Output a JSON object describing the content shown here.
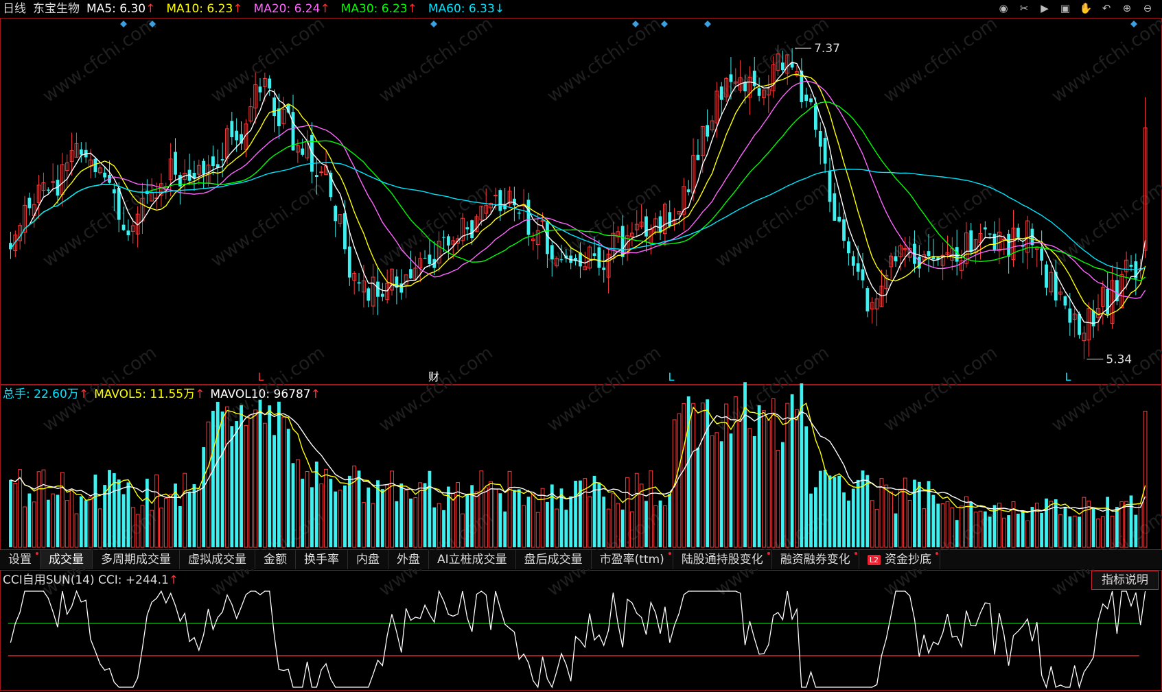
{
  "header": {
    "period": "日线",
    "stock_name": "东宝生物",
    "ma": [
      {
        "label": "MA5:",
        "value": "6.30",
        "arrow": "↑",
        "color": "#ffffff"
      },
      {
        "label": "MA10:",
        "value": "6.23",
        "arrow": "↑",
        "color": "#ffff00"
      },
      {
        "label": "MA20:",
        "value": "6.24",
        "arrow": "↑",
        "color": "#ff66ff"
      },
      {
        "label": "MA30:",
        "value": "6.23",
        "arrow": "↑",
        "color": "#00ff00"
      },
      {
        "label": "MA60:",
        "value": "6.33",
        "arrow": "↓",
        "color": "#00e5ff"
      }
    ]
  },
  "toolbar_icons": [
    "eye-icon",
    "scissors-icon",
    "play-circle-icon",
    "lock-icon",
    "hand-icon",
    "undo-icon",
    "zoom-in-icon",
    "zoom-out-icon"
  ],
  "price_annotations": {
    "high": "7.37",
    "low": "5.34"
  },
  "event_markers": [
    {
      "text": "L",
      "color": "#ff3333"
    },
    {
      "text": "财",
      "color": "#ffffff"
    },
    {
      "text": "L",
      "color": "#00e5ff"
    },
    {
      "text": "L",
      "color": "#00e5ff"
    }
  ],
  "volume_header": {
    "total": {
      "label": "总手:",
      "value": "22.60万",
      "arrow": "↑"
    },
    "mavol5": {
      "label": "MAVOL5:",
      "value": "11.55万",
      "arrow": "↑"
    },
    "mavol10": {
      "label": "MAVOL10:",
      "value": "96787",
      "arrow": "↑"
    }
  },
  "tabs": [
    {
      "label": "设置",
      "dot": true
    },
    {
      "label": "成交量",
      "active": true
    },
    {
      "label": "多周期成交量"
    },
    {
      "label": "虚拟成交量"
    },
    {
      "label": "金额"
    },
    {
      "label": "换手率"
    },
    {
      "label": "内盘"
    },
    {
      "label": "外盘"
    },
    {
      "label": "AI立桩成交量"
    },
    {
      "label": "盘后成交量"
    },
    {
      "label": "市盈率(ttm)",
      "dot": true
    },
    {
      "label": "陆股通持股变化",
      "dot": true
    },
    {
      "label": "融资融券变化",
      "dot": true
    },
    {
      "label": "资金抄底",
      "dot": true,
      "badge": "L2"
    }
  ],
  "cci": {
    "title": "CCI自用SUN(14)",
    "label": "CCI:",
    "value": "+244.1",
    "arrow": "↑",
    "help_button": "指标说明"
  },
  "watermark": "www.cfchi.com",
  "chart_data": {
    "type": "candlestick",
    "price_range": [
      5.2,
      7.55
    ],
    "high": 7.37,
    "low": 5.34
  }
}
